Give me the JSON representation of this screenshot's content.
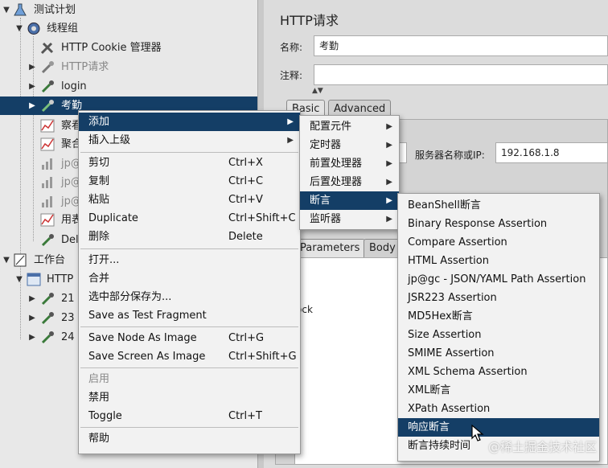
{
  "tree": {
    "test_plan": "测试计划",
    "thread_group": "线程组",
    "cookie_manager": "HTTP Cookie 管理器",
    "http_request": "HTTP请求",
    "login": "login",
    "kaoqin": "考勤",
    "child1": "察看",
    "child2": "聚合",
    "child3": "jp@",
    "child4": "jp@",
    "child5": "jp@",
    "child6": "用表",
    "child7": "Del",
    "workbench": "工作台",
    "http_node": "HTTP",
    "n21": "21",
    "n23": "23",
    "n24": "24"
  },
  "panel": {
    "title": "HTTP请求",
    "name_label": "名称:",
    "name_value": "考勤",
    "comment_label": "注释:",
    "tab_basic": "Basic",
    "tab_advanced": "Advanced",
    "server_label": "服务器名称或IP:",
    "server_value": "192.168.1.8",
    "tab_parameters": "Parameters",
    "tab_body": "Body",
    "partial_text": "ock"
  },
  "context_menu": {
    "add": "添加",
    "insert_parent": "插入上级",
    "cut": "剪切",
    "cut_key": "Ctrl+X",
    "copy": "复制",
    "copy_key": "Ctrl+C",
    "paste": "粘贴",
    "paste_key": "Ctrl+V",
    "duplicate": "Duplicate",
    "duplicate_key": "Ctrl+Shift+C",
    "delete": "删除",
    "delete_key": "Delete",
    "open": "打开...",
    "merge": "合并",
    "save_partial": "选中部分保存为...",
    "save_fragment": "Save as Test Fragment",
    "save_node_image": "Save Node As Image",
    "save_node_image_key": "Ctrl+G",
    "save_screen_image": "Save Screen As Image",
    "save_screen_image_key": "Ctrl+Shift+G",
    "enable": "启用",
    "disable": "禁用",
    "toggle": "Toggle",
    "toggle_key": "Ctrl+T",
    "help": "帮助"
  },
  "add_submenu": [
    "配置元件",
    "定时器",
    "前置处理器",
    "后置处理器",
    "断言",
    "监听器"
  ],
  "assertion_submenu": [
    "BeanShell断言",
    "Binary Response Assertion",
    "Compare Assertion",
    "HTML Assertion",
    "jp@gc - JSON/YAML Path Assertion",
    "JSR223 Assertion",
    "MD5Hex断言",
    "Size Assertion",
    "SMIME Assertion",
    "XML Schema Assertion",
    "XML断言",
    "XPath Assertion",
    "响应断言",
    "断言持续时间"
  ],
  "watermark": "@稀土掘金技术社区",
  "colors": {
    "selection": "#143e66",
    "menu_bg": "#f2f2f2"
  }
}
